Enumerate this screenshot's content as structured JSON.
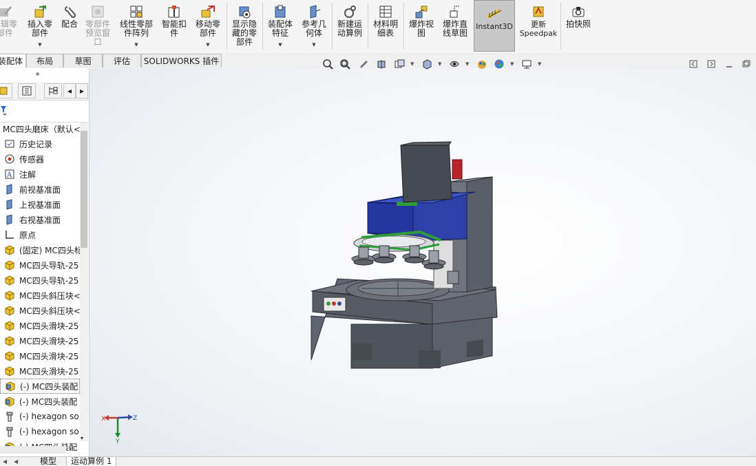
{
  "ribbon": {
    "buttons": [
      {
        "label": "编辑零\n部件"
      },
      {
        "label": "插入零\n部件"
      },
      {
        "label": "配合"
      },
      {
        "label": "零部件\n预览窗\n口"
      },
      {
        "label": "线性零部\n件阵列"
      },
      {
        "label": "智能扣\n件"
      },
      {
        "label": "移动零\n部件"
      },
      {
        "label": "显示隐\n藏的零\n部件"
      },
      {
        "label": "装配体\n特征"
      },
      {
        "label": "参考几\n何体"
      },
      {
        "label": "新建运\n动算例"
      },
      {
        "label": "材料明\n细表"
      },
      {
        "label": "爆炸视\n图"
      },
      {
        "label": "爆炸直\n线草图"
      },
      {
        "label": "Instant3D"
      },
      {
        "label": "更新\nSpeedpak"
      },
      {
        "label": "拍快照"
      }
    ]
  },
  "tabs": [
    "装配体",
    "布局",
    "草图",
    "评估",
    "SOLIDWORKS 插件"
  ],
  "tree": {
    "root": "MC四头磨床（默认<",
    "items": [
      {
        "label": "历史记录",
        "icon": "history-icon"
      },
      {
        "label": "传感器",
        "icon": "sensor-icon"
      },
      {
        "label": "注解",
        "icon": "annotation-icon"
      },
      {
        "label": "前视基准面",
        "icon": "plane-icon"
      },
      {
        "label": "上视基准面",
        "icon": "plane-icon"
      },
      {
        "label": "右视基准面",
        "icon": "plane-icon"
      },
      {
        "label": "原点",
        "icon": "origin-icon"
      },
      {
        "label": "(固定) MC四头标",
        "icon": "part-icon"
      },
      {
        "label": "MC四头导轨-25",
        "icon": "part-icon"
      },
      {
        "label": "MC四头导轨-25",
        "icon": "part-icon"
      },
      {
        "label": "MC四头斜压块<",
        "icon": "part-icon"
      },
      {
        "label": "MC四头斜压块<",
        "icon": "part-icon"
      },
      {
        "label": "MC四头滑块-25",
        "icon": "part-icon"
      },
      {
        "label": "MC四头滑块-25",
        "icon": "part-icon"
      },
      {
        "label": "MC四头滑块-25",
        "icon": "part-icon"
      },
      {
        "label": "MC四头滑块-25",
        "icon": "part-icon"
      },
      {
        "label": "(-) MC四头装配",
        "icon": "subassembly-icon"
      },
      {
        "label": "(-) MC四头装配",
        "icon": "subassembly-icon"
      },
      {
        "label": "(-) hexagon so",
        "icon": "screw-icon"
      },
      {
        "label": "(-) hexagon so",
        "icon": "screw-icon"
      },
      {
        "label": "(-) MC四头装配",
        "icon": "subassembly-icon"
      }
    ]
  },
  "bottom_tabs": [
    "模型",
    "运动算例 1"
  ],
  "triad": {
    "x": "X",
    "y": "Y",
    "z": "Z"
  }
}
